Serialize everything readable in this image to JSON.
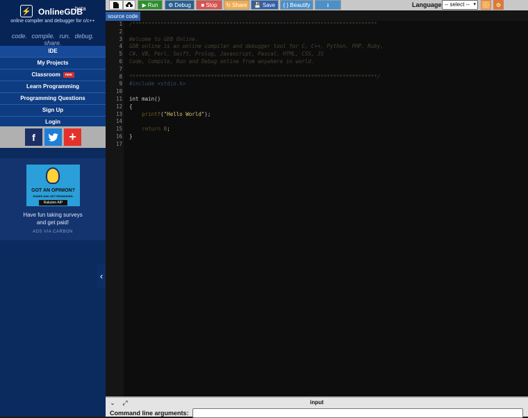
{
  "brand": {
    "name": "OnlineGDB",
    "beta": "beta",
    "tagline": "online compiler and debugger for c/c++",
    "actions": [
      "code.",
      "compile.",
      "run.",
      "debug.",
      "share."
    ]
  },
  "nav": [
    {
      "label": "IDE",
      "badge": ""
    },
    {
      "label": "My Projects",
      "badge": ""
    },
    {
      "label": "Classroom",
      "badge": "new"
    },
    {
      "label": "Learn Programming",
      "badge": ""
    },
    {
      "label": "Programming Questions",
      "badge": ""
    },
    {
      "label": "Sign Up",
      "badge": ""
    },
    {
      "label": "Login",
      "badge": ""
    }
  ],
  "social": {
    "facebook": "f",
    "twitter": "t",
    "share": "+"
  },
  "ad": {
    "headline": "GOT AN OPINION?",
    "subline": "SHARE AND GET REWARDED.",
    "brand": "Rakuten AIP",
    "text_line1": "Have fun taking surveys",
    "text_line2": "and get paid!",
    "via": "ADS VIA CARBON"
  },
  "toolbar": {
    "run": "Run",
    "debug": "Debug",
    "stop": "Stop",
    "share": "Share",
    "save": "Save",
    "beautify": "{ } Beautify",
    "language_label": "Language",
    "language_value": "-- select --"
  },
  "tabs": [
    {
      "label": "source code"
    }
  ],
  "editor": {
    "lines": [
      [
        [
          "cm",
          "/******************************************************************************"
        ]
      ],
      [
        [
          "cm",
          ""
        ]
      ],
      [
        [
          "cm",
          "Welcome to GDB Online."
        ]
      ],
      [
        [
          "cm",
          "GDB online is an online compiler and debugger tool for C, C++, Python, PHP, Ruby,"
        ]
      ],
      [
        [
          "cm",
          "C#, VB, Perl, Swift, Prolog, Javascript, Pascal, HTML, CSS, JS"
        ]
      ],
      [
        [
          "cm",
          "Code, Compile, Run and Debug online from anywhere in world."
        ]
      ],
      [
        [
          "cm",
          ""
        ]
      ],
      [
        [
          "cm",
          "*******************************************************************************/"
        ]
      ],
      [
        [
          "pp",
          "#include <stdio.h>"
        ]
      ],
      [
        [
          "txt",
          ""
        ]
      ],
      [
        [
          "txt",
          "int main()"
        ]
      ],
      [
        [
          "txt",
          "{"
        ]
      ],
      [
        [
          "txt",
          "    "
        ],
        [
          "fn",
          "printf"
        ],
        [
          "txt",
          "("
        ],
        [
          "str",
          "\"Hello World\""
        ],
        [
          "txt",
          ");"
        ]
      ],
      [
        [
          "txt",
          ""
        ]
      ],
      [
        [
          "txt",
          "    "
        ],
        [
          "kw",
          "return"
        ],
        [
          "txt",
          " "
        ],
        [
          "num",
          "0"
        ],
        [
          "txt",
          ";"
        ]
      ],
      [
        [
          "txt",
          "}"
        ]
      ],
      [
        [
          "txt",
          ""
        ]
      ]
    ]
  },
  "bottom": {
    "title": "input",
    "args_label": "Command line arguments:"
  }
}
